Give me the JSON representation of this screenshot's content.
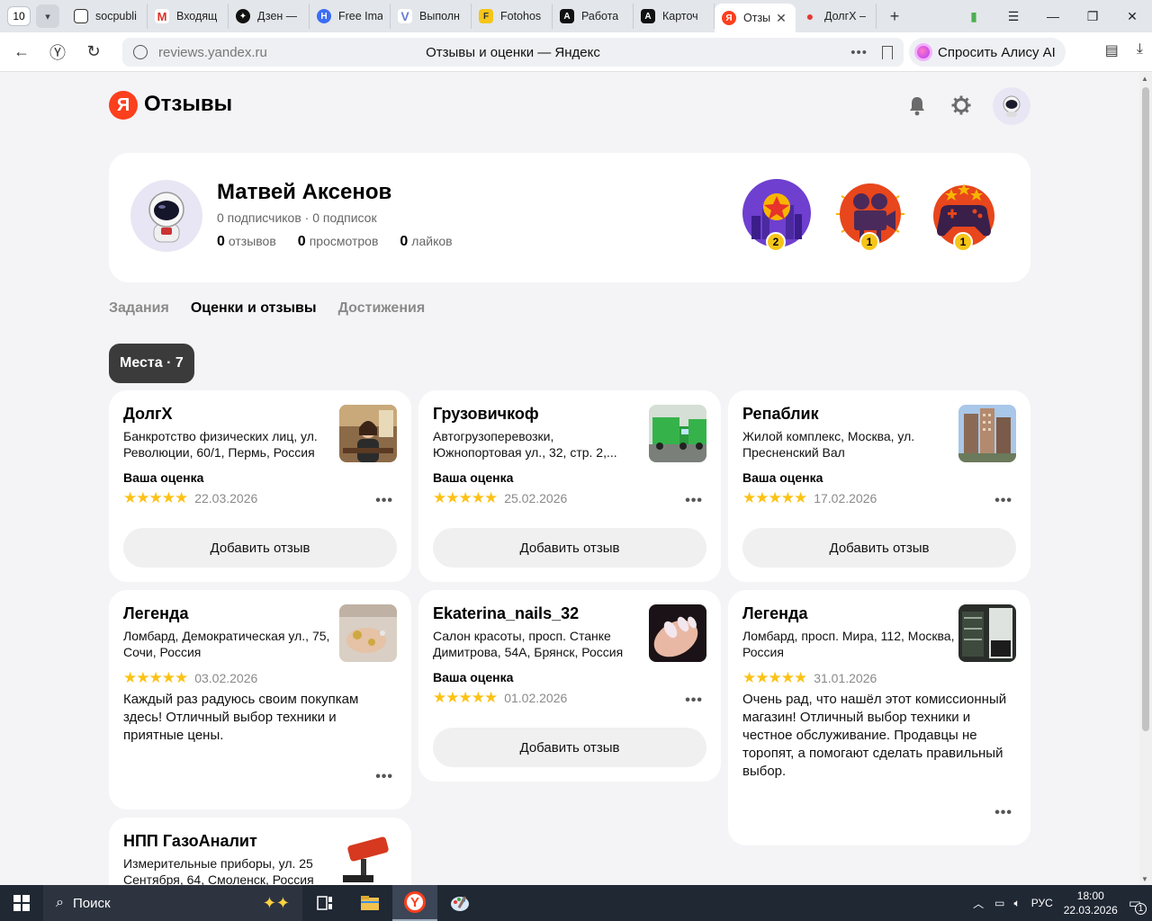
{
  "browser": {
    "tab_count": "10",
    "tabs": [
      {
        "title": "socpubli",
        "fav": "doc"
      },
      {
        "title": "Входящ",
        "fav": "gmail"
      },
      {
        "title": "Дзен —",
        "fav": "dzen"
      },
      {
        "title": "Free Ima",
        "fav": "h"
      },
      {
        "title": "Выполн",
        "fav": "v"
      },
      {
        "title": "Fotohos",
        "fav": "f"
      },
      {
        "title": "Работа",
        "fav": "a"
      },
      {
        "title": "Карточ",
        "fav": "a"
      },
      {
        "title": "Отзы",
        "fav": "y"
      },
      {
        "title": "ДолгХ –",
        "fav": "pin"
      }
    ],
    "url_host": "reviews.yandex.ru",
    "page_title": "Отзывы и оценки — Яндекс",
    "alice_label": "Спросить Алису AI"
  },
  "header": {
    "logo_letter": "Я",
    "brand": "Отзывы"
  },
  "profile": {
    "name": "Матвей Аксенов",
    "subs": "0 подписчиков · 0 подписок",
    "reviews_count": "0",
    "reviews_label": "отзывов",
    "views_count": "0",
    "views_label": "просмотров",
    "likes_count": "0",
    "likes_label": "лайков",
    "badges": [
      {
        "icon": "city-star-badge",
        "level": "2"
      },
      {
        "icon": "film-camera-badge",
        "level": "1"
      },
      {
        "icon": "gamepad-badge",
        "level": "1"
      }
    ]
  },
  "tabs": [
    "Задания",
    "Оценки и отзывы",
    "Достижения"
  ],
  "filter_chip": "Места · 7",
  "labels": {
    "your_rating": "Ваша оценка",
    "add_review": "Добавить отзыв",
    "stars": "★★★★★",
    "more": "•••"
  },
  "cards": [
    {
      "name": "ДолгХ",
      "address": "Банкротство физических лиц, ул. Революции, 60/1, Пермь, Россия",
      "date": "22.03.2026"
    },
    {
      "name": "Грузовичкоф",
      "address": "Автогрузоперевозки, Южнопортовая ул., 32, стр. 2,...",
      "date": "25.02.2026"
    },
    {
      "name": "Репаблик",
      "address": "Жилой комплекс, Москва, ул. Пресненский Вал",
      "date": "17.02.2026"
    },
    {
      "name": "Легенда",
      "address": "Ломбард, Демократическая ул., 75, Сочи, Россия",
      "date": "03.02.2026",
      "text": "Каждый раз радуюсь своим покупкам здесь! Отличный выбор техники и приятные цены."
    },
    {
      "name": "Ekaterina_nails_32",
      "address": "Салон красоты, просп. Станке Димитрова, 54А, Брянск, Россия",
      "date": "01.02.2026"
    },
    {
      "name": "Легенда",
      "address": "Ломбард, просп. Мира, 112, Москва, Россия",
      "date": "31.01.2026",
      "text": "Очень рад, что нашёл этот комиссионный магазин! Отличный выбор техники и честное обслуживание. Продавцы не торопят, а помогают сделать правильный выбор."
    },
    {
      "name": "НПП ГазоАналит",
      "address": "Измерительные приборы, ул. 25 Сентября, 64, Смоленск, Россия"
    }
  ],
  "taskbar": {
    "search_placeholder": "Поиск",
    "lang": "РУС",
    "time": "18:00",
    "date": "22.03.2026",
    "notif_count": "1"
  }
}
